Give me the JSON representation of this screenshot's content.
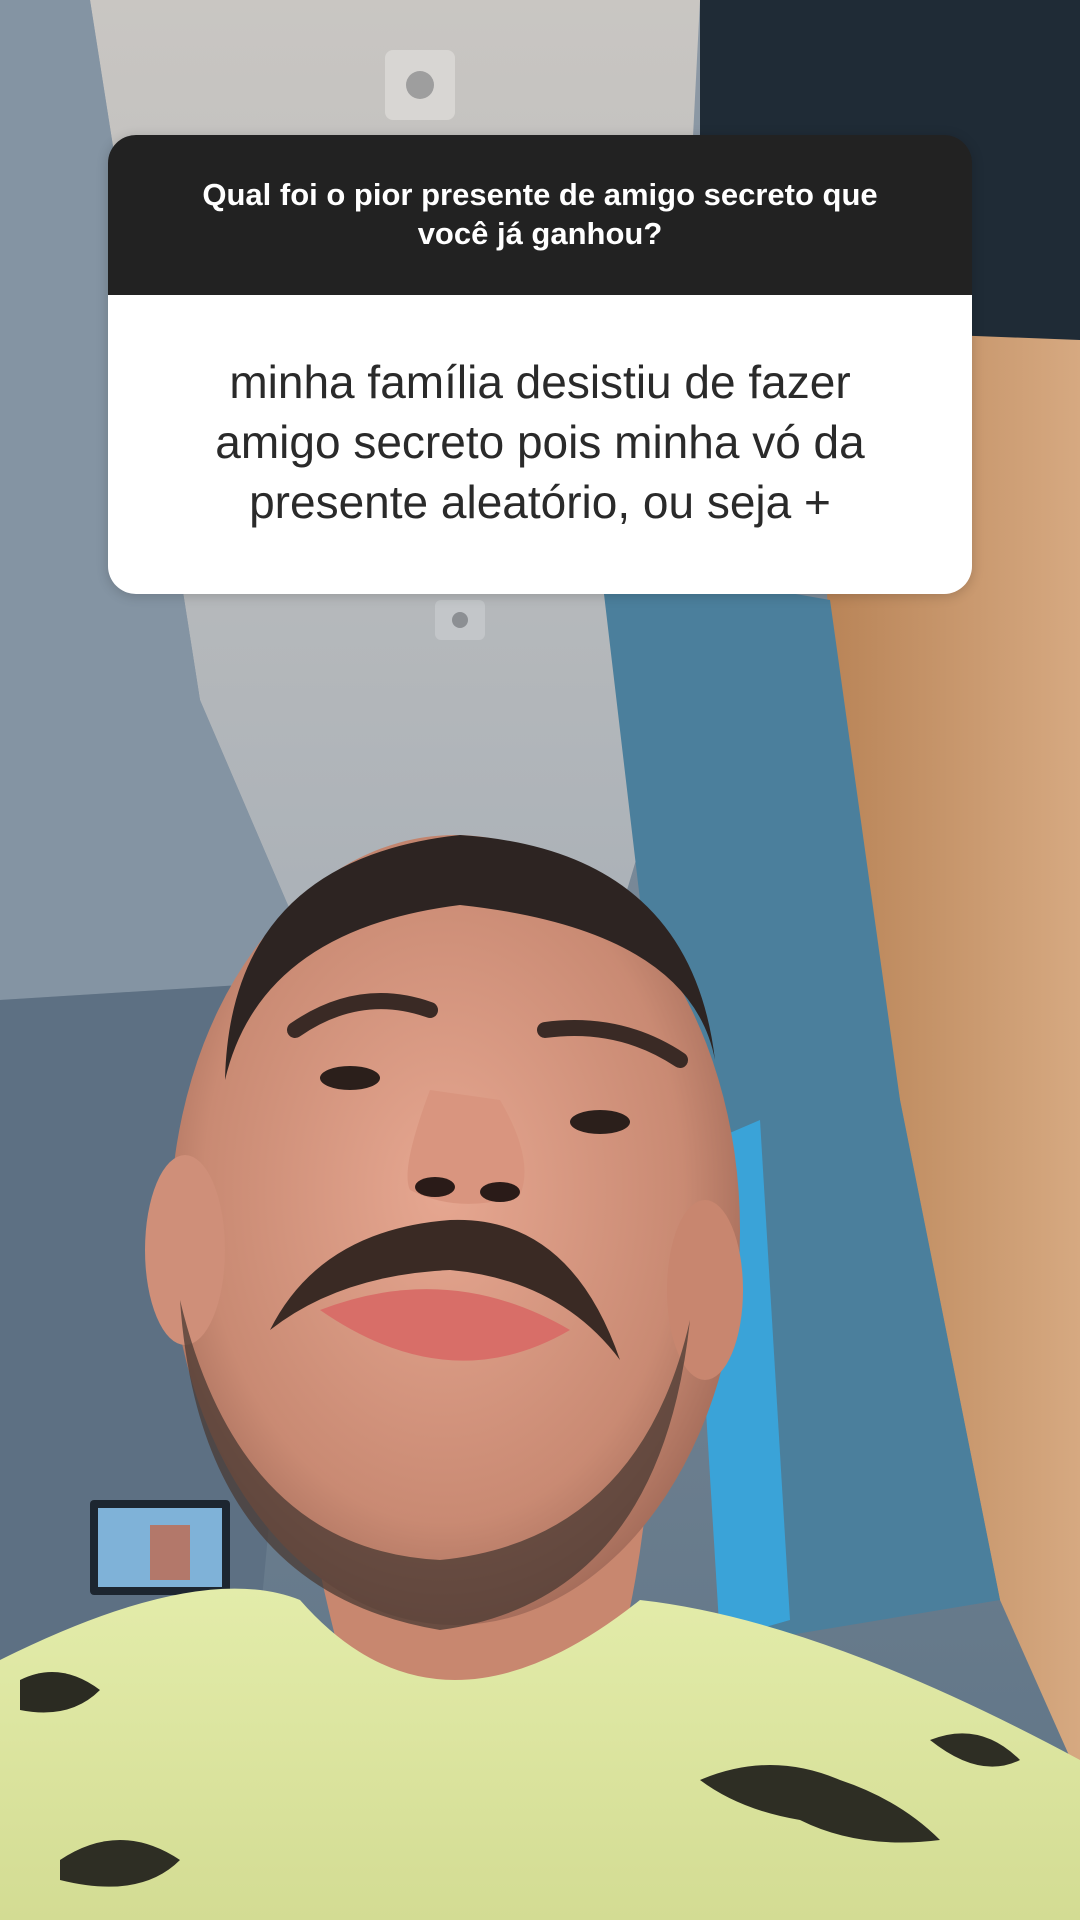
{
  "question_sticker": {
    "question": "Qual foi o pior presente de amigo secreto que você já ganhou?",
    "answer": "minha família desistiu de fazer amigo secreto pois minha vó da presente aleatório, ou seja +"
  }
}
